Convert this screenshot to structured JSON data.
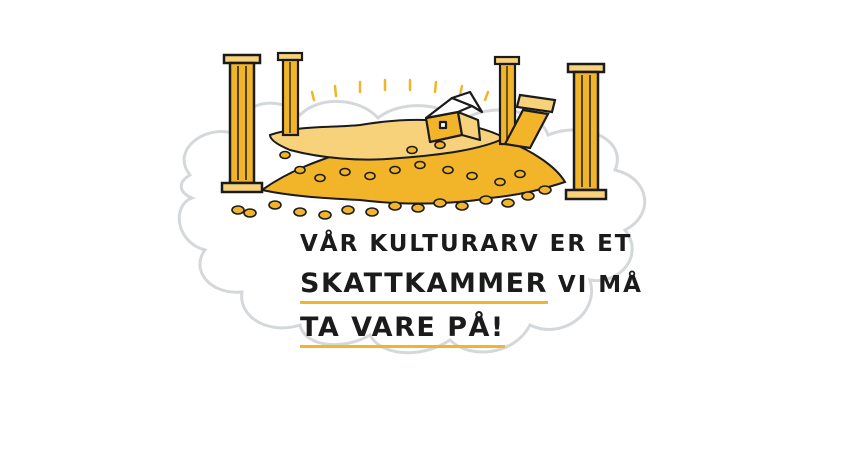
{
  "caption": {
    "line1": "VÅR KULTURARV  ER ET",
    "line2_emphasis": "SKATTKAMMER",
    "line2_rest": " VI MÅ",
    "line3_emphasis": "TA VARE PÅ!"
  },
  "colors": {
    "gold": "#f2b52a",
    "ink": "#1b1b1b",
    "cloud_outline": "#d5d8da",
    "background": "#ffffff"
  }
}
